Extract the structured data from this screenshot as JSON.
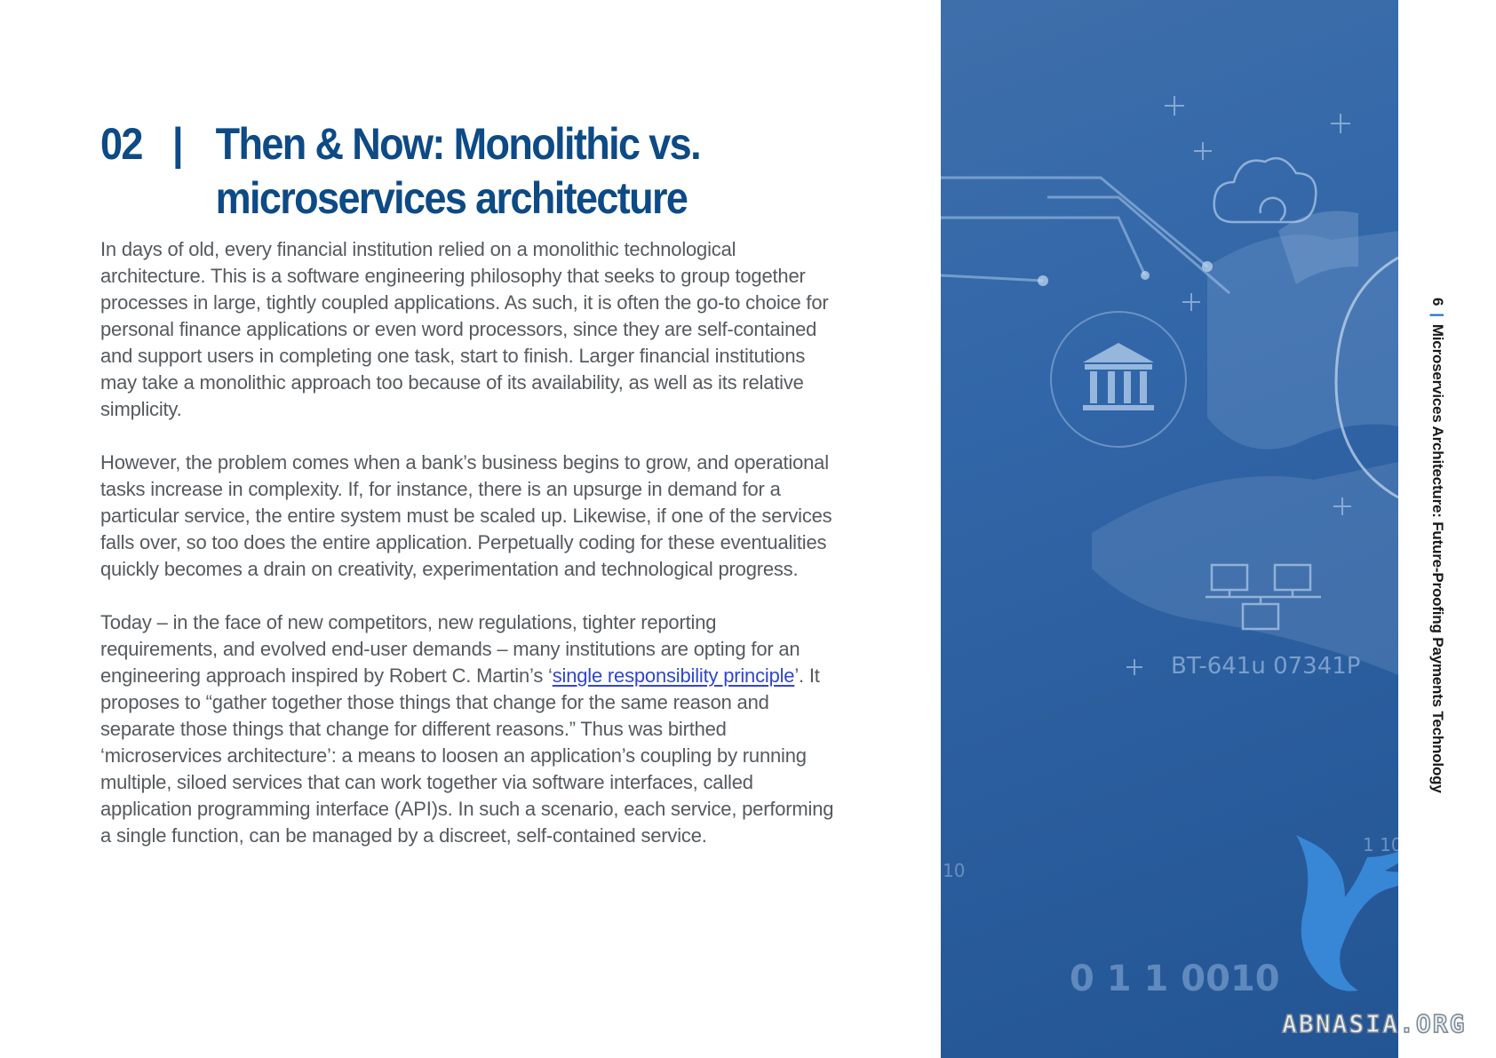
{
  "section": {
    "number": "02",
    "separator": "|",
    "title": "Then & Now: Monolithic vs. microservices architecture"
  },
  "body": {
    "p1": "In days of old, every financial institution relied on a monolithic technological architecture. This is a software engineering philosophy that seeks to group together processes in large, tightly coupled applications. As such, it is often the go-to choice for personal finance applications or even word processors, since they are self-contained and support users in completing one task, start to finish. Larger financial institutions may take a monolithic approach too because of its availability, as well as its relative simplicity.",
    "p2": "However, the problem comes when a bank’s business begins to grow, and operational tasks increase in complexity. If, for instance, there is an upsurge in demand for a particular service, the entire system must be scaled up. Likewise, if one of the services falls over, so too does the entire application. Perpetually coding for these eventualities quickly becomes a drain on creativity, experimentation and technological progress.",
    "p3_before_link": "Today – in the face of new competitors, new regulations, tighter reporting requirements, and evolved end-user demands – many institutions are opting for an engineering approach inspired by Robert C. Martin’s ‘",
    "p3_link": "single responsibility principle",
    "p3_after_link": "’. It proposes to “gather together those things that change for the same reason and separate those things that change for different reasons.” Thus was birthed ‘microservices architecture’: a means to loosen an application’s coupling by running multiple, siloed services that can work together via software interfaces, called application programming interface (API)s. In such a scenario, each service, performing a single function, can be managed by a discreet, self-contained service."
  },
  "image_panel": {
    "overlay_text_1": "BT-641u 07341P",
    "overlay_text_2": "0 1 1 0010",
    "overlay_text_3": "10",
    "overlay_text_4": "1 10",
    "icons": [
      "bank-icon",
      "cloud-sync-icon",
      "network-computers-icon",
      "eagle-logo-icon"
    ]
  },
  "footer": {
    "page_number": "6",
    "separator": "|",
    "doc_title": "Microservices Architecture: Future-Proofing Payments Technology"
  },
  "watermark": "ABNASIA.ORG",
  "colors": {
    "heading": "#0d4a86",
    "body_text": "#555a5e",
    "link": "#3147c9",
    "panel_blue": "#2f62a4",
    "footer_separator": "#1e6ec8"
  }
}
